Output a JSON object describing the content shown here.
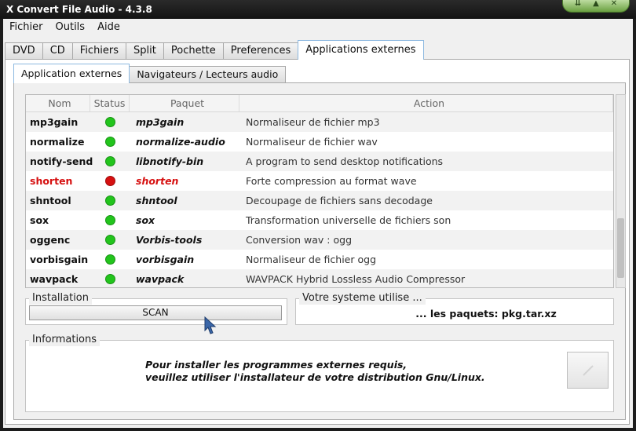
{
  "window": {
    "title": "X Convert File Audio  -  4.3.8"
  },
  "menu": [
    "Fichier",
    "Outils",
    "Aide"
  ],
  "main_tabs": [
    "DVD",
    "CD",
    "Fichiers",
    "Split",
    "Pochette",
    "Preferences",
    "Applications externes"
  ],
  "sub_tabs": [
    "Application externes",
    "Navigateurs / Lecteurs audio"
  ],
  "table": {
    "headers": {
      "nom": "Nom",
      "status": "Status",
      "paquet": "Paquet",
      "action": "Action"
    },
    "rows": [
      {
        "nom": "mp3gain",
        "status": "ok",
        "paquet": "mp3gain",
        "action": "Normaliseur de fichier mp3"
      },
      {
        "nom": "normalize",
        "status": "ok",
        "paquet": "normalize-audio",
        "action": "Normaliseur de fichier wav"
      },
      {
        "nom": "notify-send",
        "status": "ok",
        "paquet": "libnotify-bin",
        "action": "A program to send desktop notifications"
      },
      {
        "nom": "shorten",
        "status": "error",
        "paquet": "shorten",
        "action": "Forte compression au format wave"
      },
      {
        "nom": "shntool",
        "status": "ok",
        "paquet": "shntool",
        "action": "Decoupage de fichiers sans decodage"
      },
      {
        "nom": "sox",
        "status": "ok",
        "paquet": "sox",
        "action": "Transformation universelle de fichiers son"
      },
      {
        "nom": "oggenc",
        "status": "ok",
        "paquet": "Vorbis-tools",
        "action": "Conversion wav : ogg"
      },
      {
        "nom": "vorbisgain",
        "status": "ok",
        "paquet": "vorbisgain",
        "action": "Normaliseur de fichier ogg"
      },
      {
        "nom": "wavpack",
        "status": "ok",
        "paquet": "wavpack",
        "action": "WAVPACK  Hybrid Lossless Audio Compressor"
      }
    ]
  },
  "installation": {
    "title": "Installation",
    "scan_label": "SCAN"
  },
  "systeme": {
    "title": "Votre systeme utilise ...",
    "value": "... les paquets: pkg.tar.xz"
  },
  "informations": {
    "title": "Informations",
    "line1": "Pour installer les programmes externes requis,",
    "line2": "veuillez utiliser l'installateur de votre distribution Gnu/Linux."
  },
  "colors": {
    "status_ok": "#22c41c",
    "status_error": "#d61010",
    "active_tab_border": "#8cb8e0"
  }
}
